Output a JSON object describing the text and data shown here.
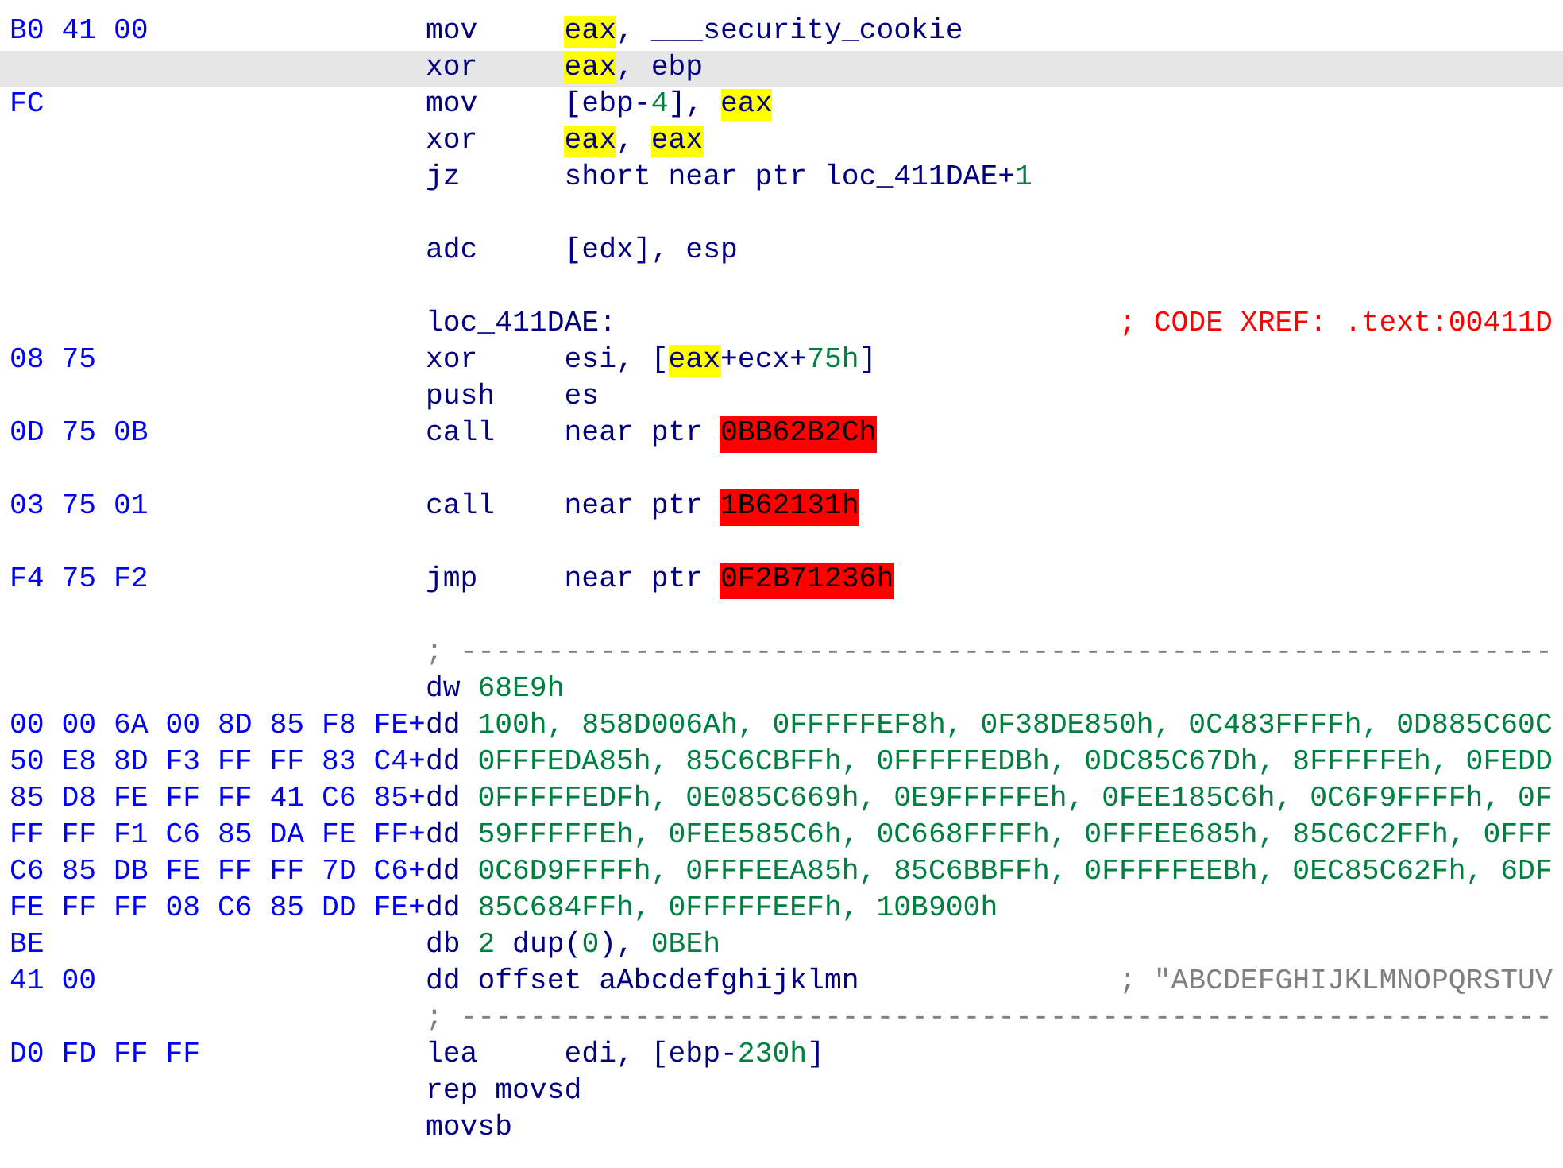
{
  "listing": [
    {
      "kind": "instr",
      "selected": false,
      "bytes": "B0 41 00",
      "mnemonic": "mov",
      "operands": [
        {
          "text": "eax",
          "kind": "hl"
        },
        {
          "text": ", ___security_cookie",
          "kind": "plain"
        }
      ]
    },
    {
      "kind": "instr",
      "selected": true,
      "mnemonic": "xor",
      "operands": [
        {
          "text": "eax",
          "kind": "hl"
        },
        {
          "text": ", ebp",
          "kind": "plain"
        }
      ]
    },
    {
      "kind": "instr",
      "selected": false,
      "bytes": "FC",
      "mnemonic": "mov",
      "operands": [
        {
          "text": "[ebp-",
          "kind": "plain"
        },
        {
          "text": "4",
          "kind": "num"
        },
        {
          "text": "], ",
          "kind": "plain"
        },
        {
          "text": "eax",
          "kind": "hl"
        }
      ]
    },
    {
      "kind": "instr",
      "selected": false,
      "mnemonic": "xor",
      "operands": [
        {
          "text": "eax",
          "kind": "hl"
        },
        {
          "text": ", ",
          "kind": "plain"
        },
        {
          "text": "eax",
          "kind": "hl"
        }
      ]
    },
    {
      "kind": "instr",
      "selected": false,
      "mnemonic": "jz",
      "operands": [
        {
          "text": "short near ptr loc_411DAE+",
          "kind": "plain"
        },
        {
          "text": "1",
          "kind": "num"
        }
      ]
    },
    {
      "kind": "blank",
      "selected": false
    },
    {
      "kind": "instr",
      "selected": false,
      "mnemonic": "adc",
      "operands": [
        {
          "text": "[edx], esp",
          "kind": "plain"
        }
      ]
    },
    {
      "kind": "blank",
      "selected": false
    },
    {
      "kind": "label",
      "selected": false,
      "label": "loc_411DAE:",
      "comment": {
        "text": "; CODE XREF: .text:00411D",
        "kind": "xref"
      }
    },
    {
      "kind": "instr",
      "selected": false,
      "bytes": "08 75",
      "mnemonic": "xor",
      "operands": [
        {
          "text": "esi, [",
          "kind": "plain"
        },
        {
          "text": "eax",
          "kind": "hl"
        },
        {
          "text": "+ecx+",
          "kind": "plain"
        },
        {
          "text": "75h",
          "kind": "num"
        },
        {
          "text": "]",
          "kind": "plain"
        }
      ]
    },
    {
      "kind": "instr",
      "selected": false,
      "mnemonic": "push",
      "operands": [
        {
          "text": "es",
          "kind": "plain"
        }
      ]
    },
    {
      "kind": "instr",
      "selected": false,
      "bytes": "0D 75 0B",
      "mnemonic": "call",
      "operands": [
        {
          "text": "near ptr ",
          "kind": "plain"
        },
        {
          "text": "0BB62B2Ch",
          "kind": "bad"
        }
      ]
    },
    {
      "kind": "blank",
      "selected": false
    },
    {
      "kind": "instr",
      "selected": false,
      "bytes": "03 75 01",
      "mnemonic": "call",
      "operands": [
        {
          "text": "near ptr ",
          "kind": "plain"
        },
        {
          "text": "1B62131h",
          "kind": "bad"
        }
      ]
    },
    {
      "kind": "blank",
      "selected": false
    },
    {
      "kind": "instr",
      "selected": false,
      "bytes": "F4 75 F2",
      "mnemonic": "jmp",
      "operands": [
        {
          "text": "near ptr ",
          "kind": "plain"
        },
        {
          "text": "0F2B71236h",
          "kind": "bad"
        }
      ]
    },
    {
      "kind": "blank",
      "selected": false
    },
    {
      "kind": "separator",
      "selected": false,
      "text": "; ---------------------------------------------------------------"
    },
    {
      "kind": "data",
      "selected": false,
      "mnemonic": "dw",
      "operands": [
        {
          "text": "68E9h",
          "kind": "num"
        }
      ]
    },
    {
      "kind": "data",
      "selected": false,
      "bytes": "00 00 6A 00 8D 85 F8 FE+",
      "mnemonic": "dd",
      "operands": [
        {
          "text": "100h, 858D006Ah, 0FFFFFEF8h, 0F38DE850h, 0C483FFFFh, 0D885C60C",
          "kind": "num"
        }
      ]
    },
    {
      "kind": "data",
      "selected": false,
      "bytes": "50 E8 8D F3 FF FF 83 C4+",
      "mnemonic": "dd",
      "operands": [
        {
          "text": "0FFFEDA85h, 85C6CBFFh, 0FFFFFEDBh, 0DC85C67Dh, 8FFFFFEh, 0FEDD",
          "kind": "num"
        }
      ]
    },
    {
      "kind": "data",
      "selected": false,
      "bytes": "85 D8 FE FF FF 41 C6 85+",
      "mnemonic": "dd",
      "operands": [
        {
          "text": "0FFFFFEDFh, 0E085C669h, 0E9FFFFFEh, 0FEE185C6h, 0C6F9FFFFh, 0F",
          "kind": "num"
        }
      ]
    },
    {
      "kind": "data",
      "selected": false,
      "bytes": "FF FF F1 C6 85 DA FE FF+",
      "mnemonic": "dd",
      "operands": [
        {
          "text": "59FFFFFEh, 0FEE585C6h, 0C668FFFFh, 0FFFEE685h, 85C6C2FFh, 0FFF",
          "kind": "num"
        }
      ]
    },
    {
      "kind": "data",
      "selected": false,
      "bytes": "C6 85 DB FE FF FF 7D C6+",
      "mnemonic": "dd",
      "operands": [
        {
          "text": "0C6D9FFFFh, 0FFFEEA85h, 85C6BBFFh, 0FFFFFEEBh, 0EC85C62Fh, 6DF",
          "kind": "num"
        }
      ]
    },
    {
      "kind": "data",
      "selected": false,
      "bytes": "FE FF FF 08 C6 85 DD FE+",
      "mnemonic": "dd",
      "operands": [
        {
          "text": "85C684FFh, 0FFFFFEEFh, 10B900h",
          "kind": "num"
        }
      ]
    },
    {
      "kind": "data",
      "selected": false,
      "bytes": "BE",
      "mnemonic": "db",
      "operands": [
        {
          "text": "2",
          "kind": "num"
        },
        {
          "text": " dup(",
          "kind": "plain"
        },
        {
          "text": "0",
          "kind": "num"
        },
        {
          "text": "), ",
          "kind": "plain"
        },
        {
          "text": "0BEh",
          "kind": "num"
        }
      ]
    },
    {
      "kind": "data",
      "selected": false,
      "bytes": "41 00",
      "mnemonic": "dd",
      "operands": [
        {
          "text": "offset aAbcdefghijklmn",
          "kind": "plain"
        }
      ],
      "comment": {
        "text": "; \"ABCDEFGHIJKLMNOPQRSTUV",
        "kind": "string"
      }
    },
    {
      "kind": "separator",
      "selected": false,
      "text": "; ---------------------------------------------------------------"
    },
    {
      "kind": "instr",
      "selected": false,
      "bytes": "D0 FD FF FF",
      "mnemonic": "lea",
      "operands": [
        {
          "text": "edi, [ebp-",
          "kind": "plain"
        },
        {
          "text": "230h",
          "kind": "num"
        },
        {
          "text": "]",
          "kind": "plain"
        }
      ]
    },
    {
      "kind": "data",
      "selected": false,
      "mnemonic": "rep movsd"
    },
    {
      "kind": "data",
      "selected": false,
      "mnemonic": "movsb"
    }
  ]
}
